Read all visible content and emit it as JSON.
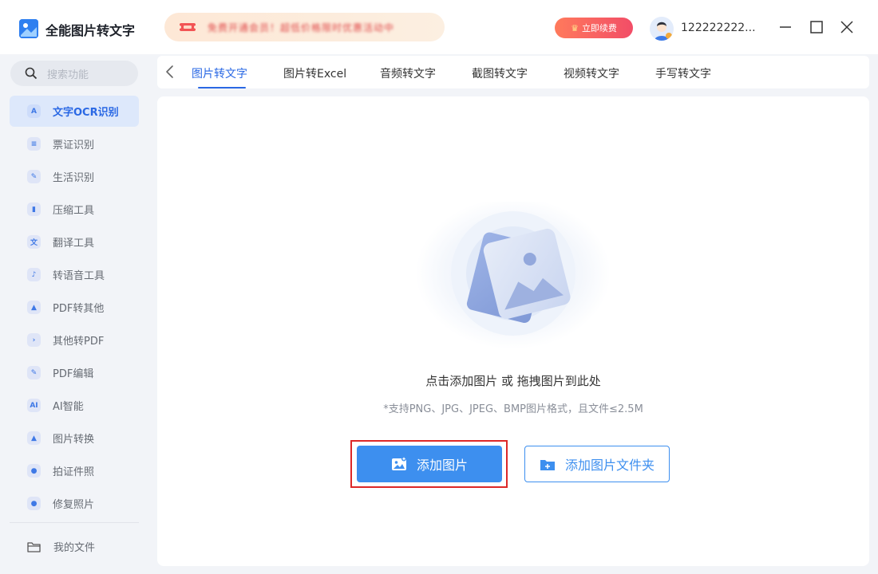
{
  "app": {
    "title": "全能图片转文字"
  },
  "header": {
    "promo_text": "免费开通会员！超低价格限时优惠活动中",
    "renew_label": "立即续费",
    "username": "122222222..."
  },
  "sidebar": {
    "search_placeholder": "搜索功能",
    "items": [
      {
        "label": "文字OCR识别",
        "icon": "A",
        "icon_name": "ocr-icon"
      },
      {
        "label": "票证识别",
        "icon": "≡",
        "icon_name": "ticket-icon"
      },
      {
        "label": "生活识别",
        "icon": "✎",
        "icon_name": "life-icon"
      },
      {
        "label": "压缩工具",
        "icon": "▮",
        "icon_name": "compress-icon"
      },
      {
        "label": "翻译工具",
        "icon": "文",
        "icon_name": "translate-icon"
      },
      {
        "label": "转语音工具",
        "icon": "♪",
        "icon_name": "voice-icon"
      },
      {
        "label": "PDF转其他",
        "icon": "▲",
        "icon_name": "pdf-convert-icon"
      },
      {
        "label": "其他转PDF",
        "icon": "›",
        "icon_name": "to-pdf-icon"
      },
      {
        "label": "PDF编辑",
        "icon": "✎",
        "icon_name": "pdf-edit-icon"
      },
      {
        "label": "AI智能",
        "icon": "AI",
        "icon_name": "ai-icon"
      },
      {
        "label": "图片转换",
        "icon": "▲",
        "icon_name": "image-convert-icon"
      },
      {
        "label": "拍证件照",
        "icon": "●",
        "icon_name": "id-photo-icon"
      },
      {
        "label": "修复照片",
        "icon": "●",
        "icon_name": "repair-photo-icon"
      }
    ],
    "files_label": "我的文件"
  },
  "tabs": [
    {
      "label": "图片转文字"
    },
    {
      "label": "图片转Excel"
    },
    {
      "label": "音频转文字"
    },
    {
      "label": "截图转文字"
    },
    {
      "label": "视频转文字"
    },
    {
      "label": "手写转文字"
    }
  ],
  "main": {
    "hint": "点击添加图片 或 拖拽图片到此处",
    "formats": "*支持PNG、JPG、JPEG、BMP图片格式，且文件≤2.5M",
    "add_image_label": "添加图片",
    "add_folder_label": "添加图片文件夹"
  },
  "colors": {
    "accent": "#2a68e4",
    "button": "#3d8fef",
    "highlight": "#dd2828",
    "renew": "#f24d67"
  }
}
